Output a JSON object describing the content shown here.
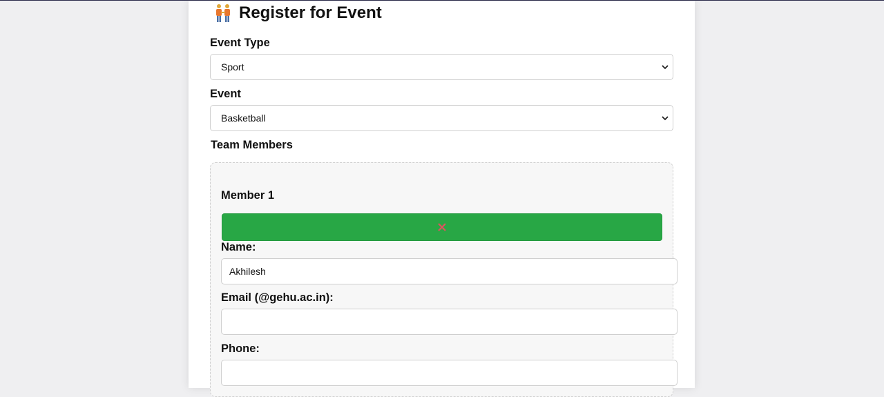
{
  "page": {
    "title": "Register for Event",
    "title_icon": "people-holding-hands-icon"
  },
  "form": {
    "event_type": {
      "label": "Event Type",
      "value": "Sport"
    },
    "event": {
      "label": "Event",
      "value": "Basketball"
    },
    "team_members_label": "Team Members",
    "members": [
      {
        "heading": "Member 1",
        "remove_icon": "close-icon",
        "name": {
          "label": "Name:",
          "value": "Akhilesh"
        },
        "email": {
          "label": "Email (@gehu.ac.in):",
          "value": ""
        },
        "phone": {
          "label": "Phone:",
          "value": ""
        }
      }
    ]
  },
  "colors": {
    "remove_button": "#28a745",
    "remove_icon": "#e05260",
    "background": "#efeff1"
  }
}
